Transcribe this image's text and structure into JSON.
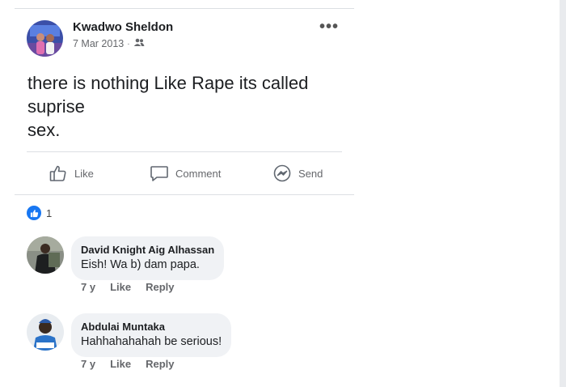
{
  "post": {
    "author": "Kwadwo Sheldon",
    "date": "7 Mar 2013",
    "separator": "·",
    "text_line1": "there is nothing Like Rape its called",
    "text_line2": "suprise",
    "text_line3": "sex.",
    "more_icon": "•••"
  },
  "actions": {
    "like_label": "Like",
    "comment_label": "Comment",
    "send_label": "Send"
  },
  "reactions": {
    "count": "1"
  },
  "comments": [
    {
      "name": "David Knight Aig Alhassan",
      "text": "Eish! Wa b) dam papa.",
      "time": "7 y",
      "like": "Like",
      "reply": "Reply"
    },
    {
      "name": "Abdulai Muntaka",
      "text": "Hahhahahahah be serious!",
      "time": "7 y",
      "like": "Like",
      "reply": "Reply"
    }
  ],
  "colors": {
    "accent": "#1877f2",
    "muted": "#65676b",
    "bubble": "#f0f2f5"
  }
}
